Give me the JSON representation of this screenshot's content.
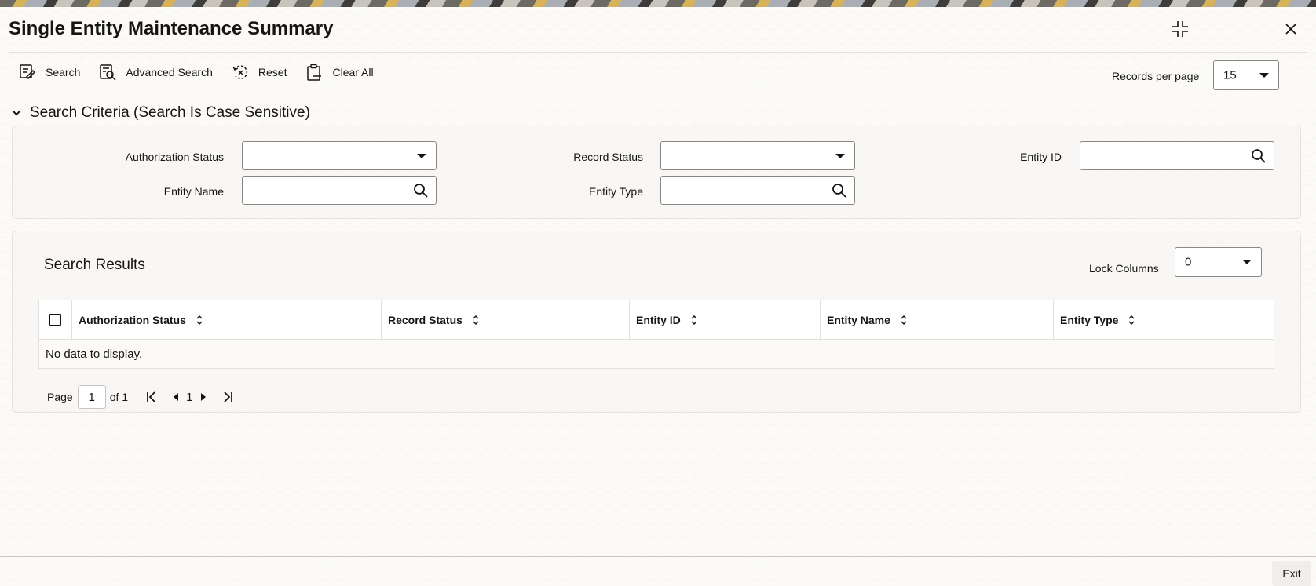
{
  "window": {
    "title": "Single Entity Maintenance Summary",
    "maximize_icon": "collapse-icon",
    "close_icon": "close-icon"
  },
  "toolbar": {
    "search_label": "Search",
    "advanced_search_label": "Advanced Search",
    "reset_label": "Reset",
    "clear_all_label": "Clear All"
  },
  "records_per_page": {
    "label": "Records per page",
    "value": "15"
  },
  "criteria": {
    "header": "Search Criteria (Search Is Case Sensitive)",
    "fields": {
      "authorization_status": {
        "label": "Authorization Status",
        "value": ""
      },
      "record_status": {
        "label": "Record Status",
        "value": ""
      },
      "entity_id": {
        "label": "Entity ID",
        "value": ""
      },
      "entity_name": {
        "label": "Entity Name",
        "value": ""
      },
      "entity_type": {
        "label": "Entity Type",
        "value": ""
      }
    }
  },
  "results": {
    "title": "Search Results",
    "lock_columns": {
      "label": "Lock Columns",
      "value": "0"
    },
    "columns": [
      "Authorization Status",
      "Record Status",
      "Entity ID",
      "Entity Name",
      "Entity Type"
    ],
    "empty_message": "No data to display.",
    "pagination": {
      "page_label": "Page",
      "current_page": "1",
      "of_label": "of 1",
      "page_number": "1"
    }
  },
  "footer": {
    "exit_label": "Exit"
  },
  "colors": {
    "text": "#161513",
    "border": "#8a8782",
    "panel": "#f7f6f4",
    "background": "#fbfaf8"
  }
}
